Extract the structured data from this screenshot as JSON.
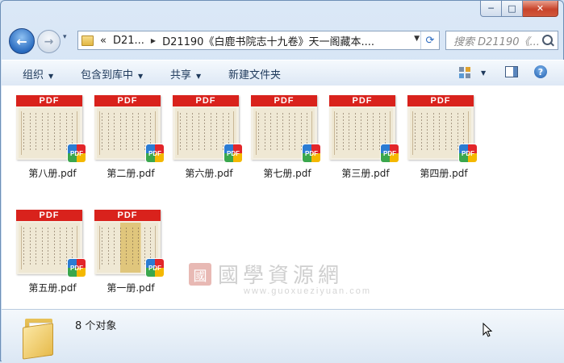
{
  "nav": {
    "recent_caret": "▾",
    "crumbs": [
      "«",
      "D21...",
      "D21190《白鹿书院志十九卷》天一阁藏本...."
    ],
    "search_placeholder": "搜索 D21190《..."
  },
  "toolbar": {
    "organize": "组织",
    "include_library": "包含到库中",
    "share": "共享",
    "new_folder": "新建文件夹"
  },
  "window_controls": {
    "minimize": "─",
    "maximize": "□",
    "close": "✕"
  },
  "files": [
    {
      "name": "第八册.pdf",
      "badge": "PDF",
      "band": "PDF"
    },
    {
      "name": "第二册.pdf",
      "badge": "PDF",
      "band": "PDF"
    },
    {
      "name": "第六册.pdf",
      "badge": "PDF",
      "band": "PDF"
    },
    {
      "name": "第七册.pdf",
      "badge": "PDF",
      "band": "PDF"
    },
    {
      "name": "第三册.pdf",
      "badge": "PDF",
      "band": "PDF"
    },
    {
      "name": "第四册.pdf",
      "badge": "PDF",
      "band": "PDF"
    },
    {
      "name": "第五册.pdf",
      "badge": "PDF",
      "band": "PDF"
    },
    {
      "name": "第一册.pdf",
      "badge": "PDF",
      "band": "PDF"
    }
  ],
  "watermark": {
    "seal": "國",
    "text": "國學資源網",
    "url": "www.guoxueziyuan.com"
  },
  "details": {
    "count": "8 个对象"
  },
  "icons": [
    "back-arrow-icon",
    "forward-arrow-icon",
    "folder-icon",
    "refresh-icon",
    "search-icon",
    "view-icon",
    "preview-pane-icon",
    "help-icon",
    "pdf-badge-icon",
    "large-folder-icon",
    "mouse-cursor-icon"
  ]
}
